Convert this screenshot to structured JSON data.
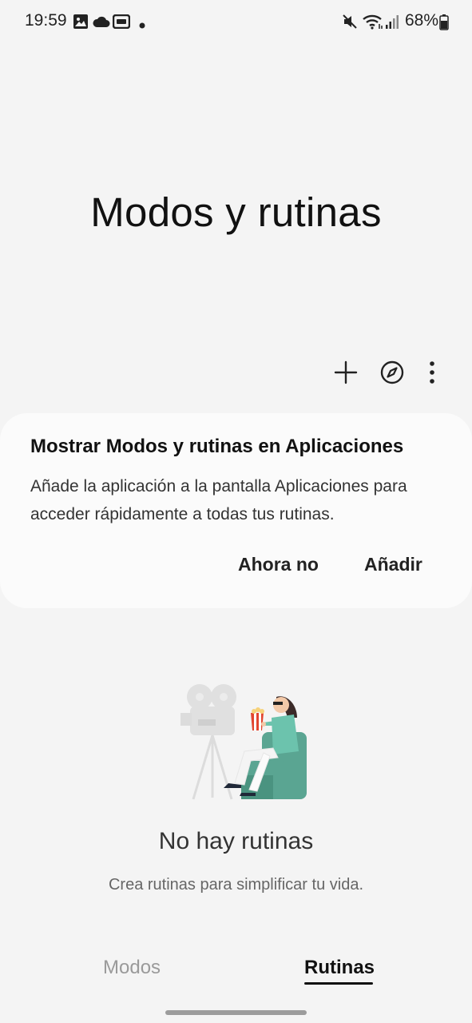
{
  "status_bar": {
    "time": "19:59",
    "battery": "68%",
    "icons": [
      "image-icon",
      "cloud-icon",
      "cast-icon",
      "dot-icon",
      "mute-icon",
      "wifi-icon",
      "signal-icon",
      "battery-icon"
    ]
  },
  "header": {
    "title": "Modos y rutinas",
    "actions": [
      "add-icon",
      "discover-icon",
      "more-options-icon"
    ]
  },
  "card": {
    "title": "Mostrar Modos y rutinas en Aplicaciones",
    "body": "Añade la aplicación a la pantalla Aplicaciones para acceder rápidamente a todas tus rutinas.",
    "dismiss_label": "Ahora no",
    "add_label": "Añadir"
  },
  "empty_state": {
    "title": "No hay rutinas",
    "subtitle": "Crea rutinas para simplificar tu vida."
  },
  "tabs": [
    {
      "label": "Modos",
      "selected": false
    },
    {
      "label": "Rutinas",
      "selected": true
    }
  ],
  "colors": {
    "background": "#f4f4f4",
    "card": "#fbfbfb",
    "chair": "#5aa592",
    "popcorn": "#e2452f"
  }
}
